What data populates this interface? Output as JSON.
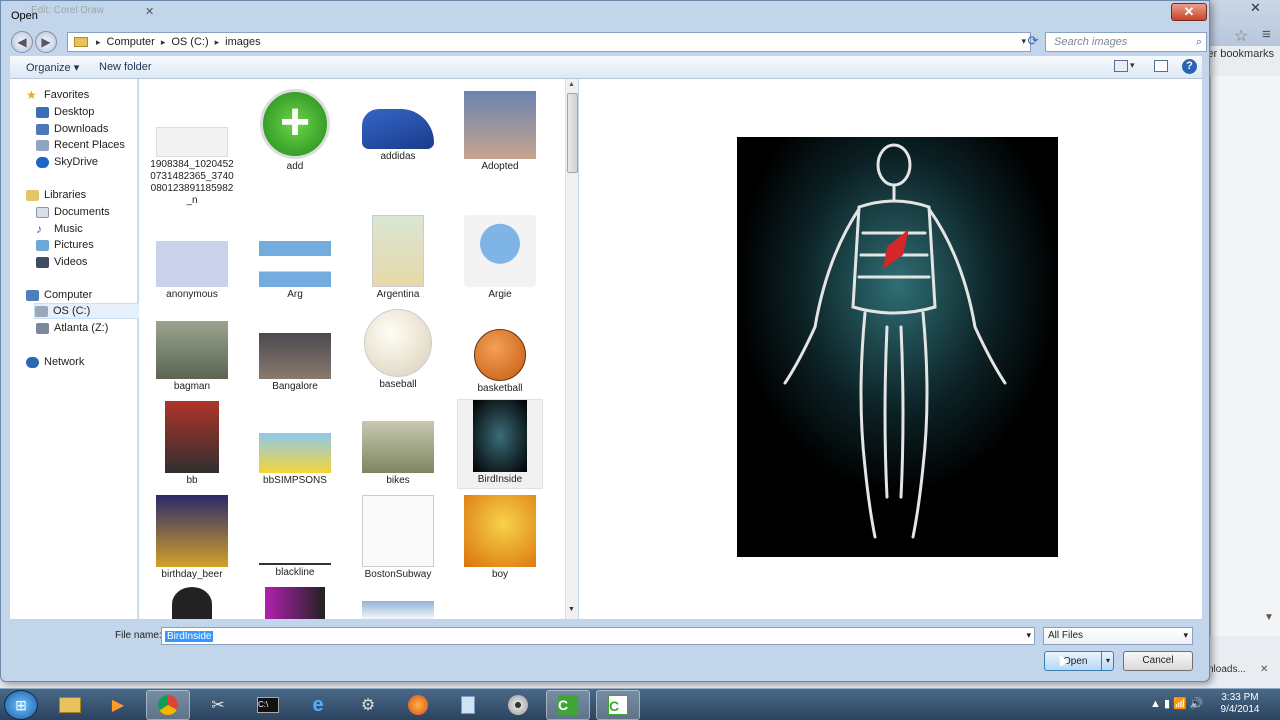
{
  "background": {
    "other_bookmarks": "ther bookmarks",
    "downloads": "nloads...",
    "faded_tab": "Edit: Corel Draw"
  },
  "dialog": {
    "title": "Open",
    "close": "✕"
  },
  "address": {
    "crumbs": [
      "Computer",
      "OS (C:)",
      "images"
    ],
    "search_placeholder": "Search images"
  },
  "toolbar": {
    "organize": "Organize ▾",
    "new_folder": "New folder"
  },
  "nav": {
    "favorites": "Favorites",
    "desktop": "Desktop",
    "downloads": "Downloads",
    "recent": "Recent Places",
    "skydrive": "SkyDrive",
    "libraries": "Libraries",
    "documents": "Documents",
    "music": "Music",
    "pictures": "Pictures",
    "videos": "Videos",
    "computer": "Computer",
    "os_c": "OS (C:)",
    "atlanta": "Atlanta (Z:)",
    "network": "Network"
  },
  "files": {
    "f0": "1908384_10204520731482365_3740080123891185982_n",
    "f1": "add",
    "f2": "addidas",
    "f3": "Adopted",
    "f4": "anonymous",
    "f5": "Arg",
    "f6": "Argentina",
    "f7": "Argie",
    "f8": "bagman",
    "f9": "Bangalore",
    "f10": "baseball",
    "f11": "basketball",
    "f12": "bb",
    "f13": "bbSIMPSONS",
    "f14": "bikes",
    "f15": "BirdInside",
    "f16": "birthday_beer",
    "f17": "blackline",
    "f18": "BostonSubway",
    "f19": "boy"
  },
  "bottom": {
    "file_name_label": "File name:",
    "file_name_value": "BirdInside",
    "filter": "All Files",
    "open": "Open",
    "cancel": "Cancel"
  },
  "taskbar": {
    "time": "3:33 PM",
    "date": "9/4/2014"
  },
  "colors": {
    "selection": "#3399ff",
    "dialog_frame": "#c3d5ea",
    "taskbar": "#2b4460"
  }
}
